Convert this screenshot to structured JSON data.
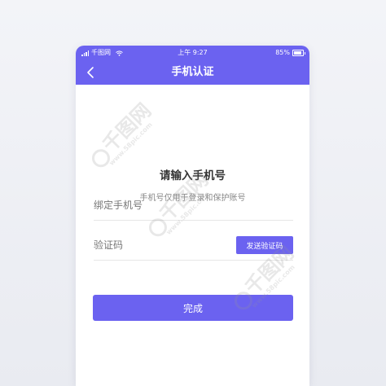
{
  "status_bar": {
    "carrier": "千图网",
    "time": "上午 9:27",
    "battery": "85%",
    "battery_level": 0.85
  },
  "nav": {
    "back_icon": "chevron-left-icon",
    "title": "手机认证"
  },
  "heading": "请输入手机号",
  "subheading": "手机号仅用于登录和保护账号",
  "phone_field": {
    "value": "",
    "placeholder": "绑定手机号"
  },
  "code_field": {
    "value": "",
    "placeholder": "验证码"
  },
  "send_code_label": "发送验证码",
  "submit_label": "完成",
  "watermark": {
    "text": "千图网",
    "sub": "www.58pic.com"
  },
  "colors": {
    "accent": "#6b62f0",
    "background": "#eef0f5"
  }
}
